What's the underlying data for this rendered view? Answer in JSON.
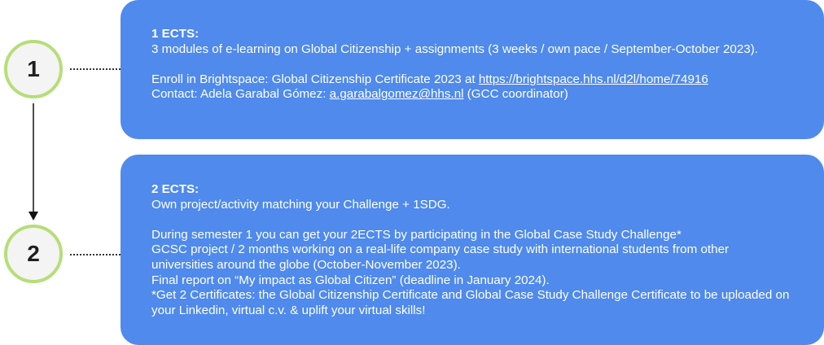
{
  "steps": [
    {
      "number": "1",
      "heading": "1 ECTS:",
      "description": "3 modules of e-learning on Global Citizenship + assignments (3 weeks / own pace / September-October 2023).",
      "enroll_prefix": "Enroll in Brightspace: Global Citizenship Certificate 2023 at ",
      "enroll_link": "https://brightspace.hhs.nl/d2l/home/74916",
      "contact_prefix": "Contact: Adela Garabal Gómez: ",
      "contact_email": "a.garabalgomez@hhs.nl",
      "contact_suffix": " (GCC coordinator)"
    },
    {
      "number": "2",
      "heading": "2 ECTS:",
      "description": "Own project/activity matching your Challenge + 1SDG.",
      "paragraph_lines": [
        "During semester 1 you can get your 2ECTS by participating in the Global Case Study Challenge*",
        "GCSC project / 2 months working on a real-life company case study with international students from other universities around the globe (October-November 2023).",
        "Final report on “My impact as Global Citizen” (deadline in January 2024).",
        "*Get 2 Certificates: the Global Citizenship Certificate and Global Case Study Challenge Certificate to be uploaded on your Linkedin, virtual c.v. & uplift your virtual skills!"
      ]
    }
  ],
  "colors": {
    "card": "#4f8aec",
    "circle_fill": "#f3f4f3",
    "circle_border": "#b6de79",
    "text_on_card": "#ffffff"
  }
}
